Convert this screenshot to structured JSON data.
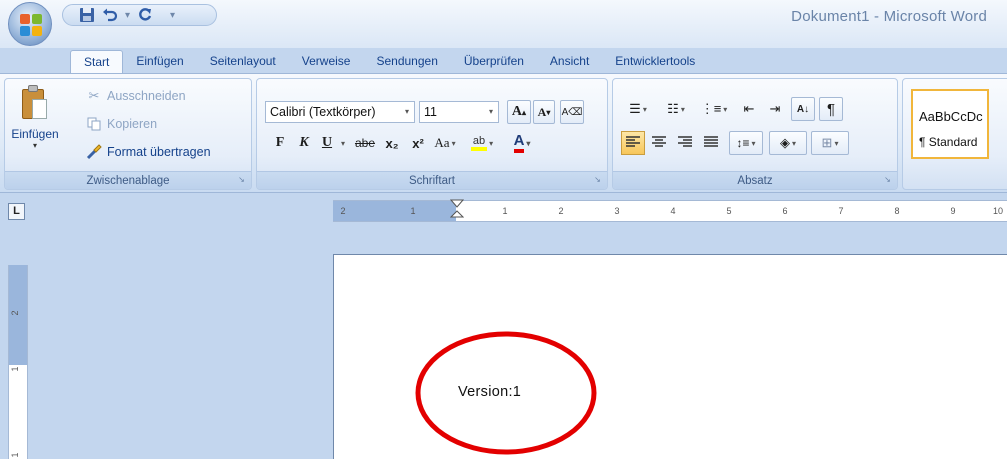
{
  "window": {
    "title": "Dokument1 - Microsoft Word"
  },
  "icons": {
    "office_button": "office-logo-icon",
    "save": "floppy-disk-icon",
    "undo": "undo-icon",
    "redo": "redo-icon",
    "customize": "customize-qat-icon"
  },
  "tabs": [
    "Start",
    "Einfügen",
    "Seitenlayout",
    "Verweise",
    "Sendungen",
    "Überprüfen",
    "Ansicht",
    "Entwicklertools"
  ],
  "active_tab": "Start",
  "clipboard": {
    "label": "Zwischenablage",
    "paste": "Einfügen",
    "cut": "Ausschneiden",
    "copy": "Kopieren",
    "format_painter": "Format übertragen"
  },
  "font": {
    "label": "Schriftart",
    "family": "Calibri (Textkörper)",
    "size": "11",
    "bold": "F",
    "italic": "K",
    "underline": "U",
    "strike": "abe",
    "subscript": "x₂",
    "superscript": "x²",
    "change_case": "Aa",
    "highlight": "ab",
    "font_color": "A",
    "grow": "A",
    "shrink": "A"
  },
  "paragraph": {
    "label": "Absatz",
    "show_marks": "¶",
    "sort": "A↓"
  },
  "styles": {
    "sample": "AaBbCcDc",
    "name": "¶ Standard"
  },
  "ruler": {
    "numbers": [
      "2",
      "1",
      "1",
      "2",
      "3",
      "4",
      "5",
      "6",
      "7",
      "8",
      "9",
      "10"
    ],
    "vertical_numbers": [
      "2",
      "1",
      "1"
    ]
  },
  "document": {
    "text": "Version:1"
  },
  "colors": {
    "annotation": "#e30000",
    "ribbon_text": "#15428b",
    "accent_highlight": "#f7c65a"
  }
}
